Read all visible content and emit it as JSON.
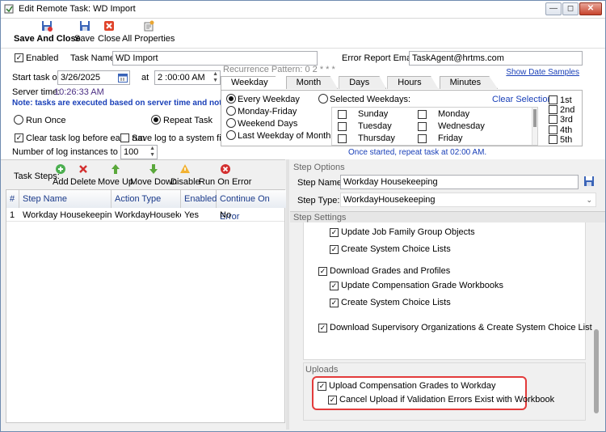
{
  "window": {
    "title": "Edit Remote Task: WD Import",
    "min": "—",
    "max": "◻",
    "close": "✕"
  },
  "toolbar": {
    "save_and_close": "Save And Close",
    "save": "Save",
    "close": "Close",
    "all_properties": "All Properties"
  },
  "task": {
    "enabled_label": "Enabled",
    "name_label": "Task Name:",
    "name_value": "WD Import",
    "email_label": "Error Report Email:",
    "email_value": "TaskAgent@hrtms.com",
    "start_label": "Start task on",
    "start_date": "3/26/2025",
    "at_label": "at",
    "start_time": "2 :00:00 AM",
    "server_time_label": "Server time:",
    "server_time": "10:26:33 AM",
    "note": "Note: tasks are executed based on server time and not your local time!",
    "run_once": "Run Once",
    "repeat_task": "Repeat Task",
    "clear_log": "Clear task log before each run",
    "save_log": "Save log to a system file",
    "log_instances_label": "Number of log instances to keep:",
    "log_instances_value": "100"
  },
  "recurrence": {
    "pattern_label": "Recurrence Pattern: 0 2 * * *",
    "show_samples": "Show Date Samples",
    "tabs": [
      "Weekday",
      "Month",
      "Days",
      "Hours",
      "Minutes"
    ],
    "options": [
      "Every Weekday",
      "Monday-Friday",
      "Weekend Days",
      "Last Weekday of Month"
    ],
    "selected_weekdays": "Selected Weekdays:",
    "clear_selection": "Clear Selection",
    "days_col1": [
      "Sunday",
      "Tuesday",
      "Thursday"
    ],
    "days_col2": [
      "Monday",
      "Wednesday",
      "Friday"
    ],
    "ordinals": [
      "1st",
      "2nd",
      "3rd",
      "4th",
      "5th"
    ],
    "summary": "Once started, repeat task at 02:00 AM."
  },
  "steps_toolbar": {
    "label": "Task Steps:",
    "add": "Add",
    "delete": "Delete",
    "move_up": "Move Up",
    "move_down": "Move Down",
    "disable": "Disable",
    "run_on_error": "Run On Error"
  },
  "grid": {
    "headers": [
      "#",
      "Step Name",
      "Action Type",
      "Enabled",
      "Continue On Error"
    ],
    "rows": [
      {
        "num": "1",
        "name": "Workday Housekeeping",
        "action": "WorkdayHousekeeping",
        "enabled": "Yes",
        "continue": "No"
      }
    ]
  },
  "step_options": {
    "section": "Step Options",
    "name_label": "Step Name:",
    "name_value": "Workday Housekeeping",
    "type_label": "Step Type:",
    "type_value": "WorkdayHousekeeping"
  },
  "step_settings": {
    "section": "Step Settings",
    "items": [
      "Update Job Family Group Objects",
      "Create System Choice Lists",
      "Download Grades and Profiles",
      "Update Compensation Grade Workbooks",
      "Create System Choice Lists",
      "Download Supervisory Organizations & Create System Choice List"
    ],
    "uploads_label": "Uploads",
    "upload_item": "Upload Compensation Grades to Workday",
    "cancel_item": "Cancel Upload if Validation Errors Exist with Workbook"
  },
  "colors": {
    "highlight": "#e33b3b",
    "link": "#1a40b8",
    "server_time": "#4b2e83"
  }
}
